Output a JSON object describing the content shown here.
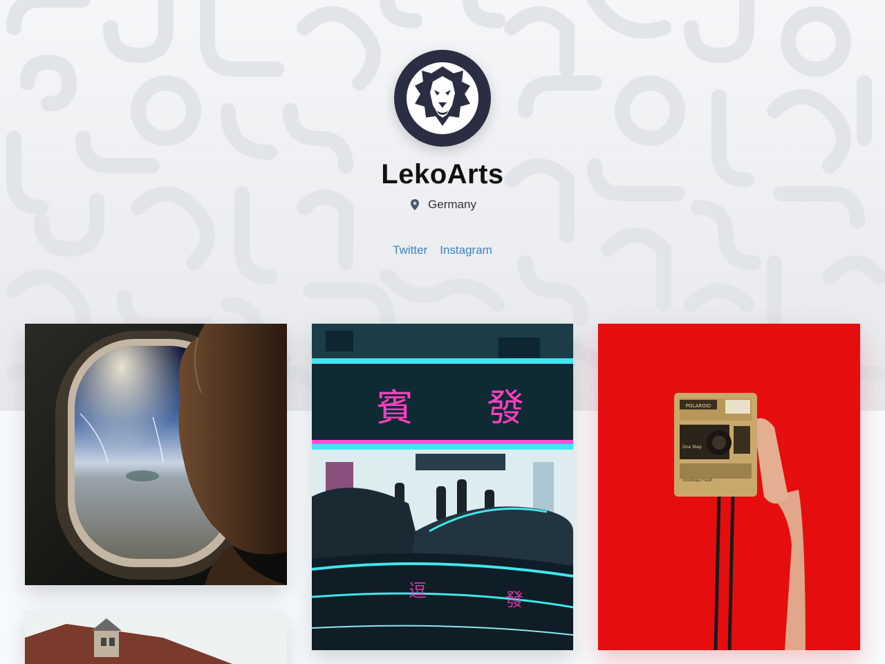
{
  "profile": {
    "name": "LekoArts",
    "location": "Germany",
    "avatar_icon": "lion-logo-icon"
  },
  "socials": [
    {
      "label": "Twitter"
    },
    {
      "label": "Instagram"
    }
  ],
  "colors": {
    "link": "#3b82c4",
    "avatar_bg": "#2b2d42",
    "hero_bg": "#eceef1"
  },
  "gallery": [
    {
      "name": "airplane-window-photo"
    },
    {
      "name": "neon-street-photo"
    },
    {
      "name": "polaroid-camera-photo"
    },
    {
      "name": "house-roof-photo"
    }
  ]
}
